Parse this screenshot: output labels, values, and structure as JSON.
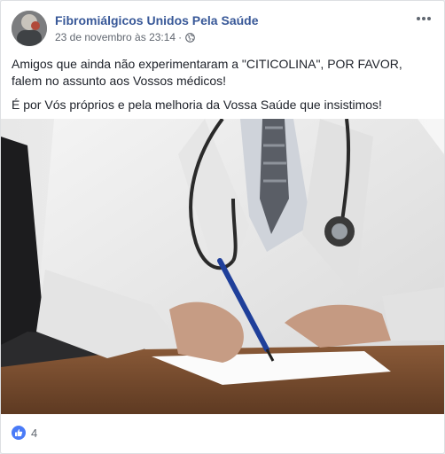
{
  "post": {
    "page_name": "Fibromiálgicos Unidos Pela Saúde",
    "timestamp": "23 de novembro às 23:14",
    "separator": "·",
    "privacy_icon": "globe-icon",
    "menu_icon": "more-options-icon",
    "paragraphs": [
      "Amigos que ainda não experimentaram a \"CITICOLINA\", POR FAVOR, falem no assunto aos Vossos médicos!",
      "É por Vós próprios e pela melhoria da Vossa Saúde que insistimos!"
    ],
    "reactions": {
      "icon": "like-icon",
      "count": "4"
    }
  },
  "colors": {
    "page_name": "#385898",
    "meta": "#616770",
    "text": "#1d2129",
    "like_badge": "#4a7bf7"
  }
}
